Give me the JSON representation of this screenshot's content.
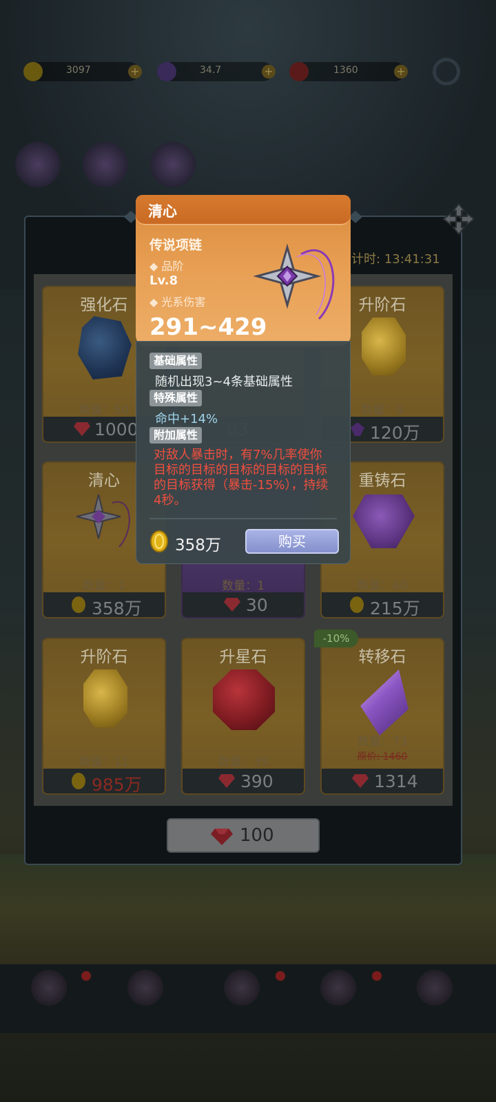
{
  "hud": {
    "coins": "3097",
    "purple": "34.7",
    "gems": "1360",
    "icons": [
      "coin-icon",
      "purple-crystal-icon",
      "ruby-icon",
      "gear-icon"
    ]
  },
  "shop": {
    "timer_label": "计时:",
    "timer_value": "13:41:31",
    "refresh_price": "100",
    "items": [
      {
        "name": "强化石",
        "count": "数量：50",
        "price": "1000",
        "currency": "ruby"
      },
      {
        "name": "",
        "count": "",
        "price": "83",
        "currency": "ruby"
      },
      {
        "name": "升阶石",
        "count": "数量：9",
        "price": "120万",
        "currency": "purple"
      },
      {
        "name": "清心",
        "count": "数量：1",
        "price": "358万",
        "currency": "coin"
      },
      {
        "name": "",
        "count": "数量：1",
        "price": "30",
        "currency": "ruby"
      },
      {
        "name": "重铸石",
        "count": "数量：60",
        "price": "215万",
        "currency": "coin"
      },
      {
        "name": "升阶石",
        "count": "数量：11",
        "price": "985万",
        "currency": "coin"
      },
      {
        "name": "升星石",
        "count": "数量：39",
        "price": "390",
        "currency": "ruby"
      },
      {
        "name": "转移石",
        "count": "数量：73",
        "price": "1314",
        "currency": "ruby",
        "discount": "-10%",
        "original": "原价: 1460"
      }
    ]
  },
  "tooltip": {
    "title": "清心",
    "type": "传说项链",
    "rank_label": "品阶",
    "level": "Lv.8",
    "damage_label": "光系伤害",
    "damage": "291~429",
    "base_tag": "基础属性",
    "base_text": "随机出现3~4条基础属性",
    "special_tag": "特殊属性",
    "special_text": "命中+14%",
    "extra_tag": "附加属性",
    "extra_text": "对敌人暴击时，有7%几率使你目标的目标的目标的目标的目标的目标获得（暴击-15%），持续4秒。",
    "price": "358万",
    "buy_label": "购买"
  },
  "colors": {
    "tooltip_header": "#e79e52",
    "buy_button": "#8e9ad4",
    "extra_text": "#ef4f3f",
    "special_text": "#9fd3ea",
    "discount_tag": "#3c5a2a"
  }
}
